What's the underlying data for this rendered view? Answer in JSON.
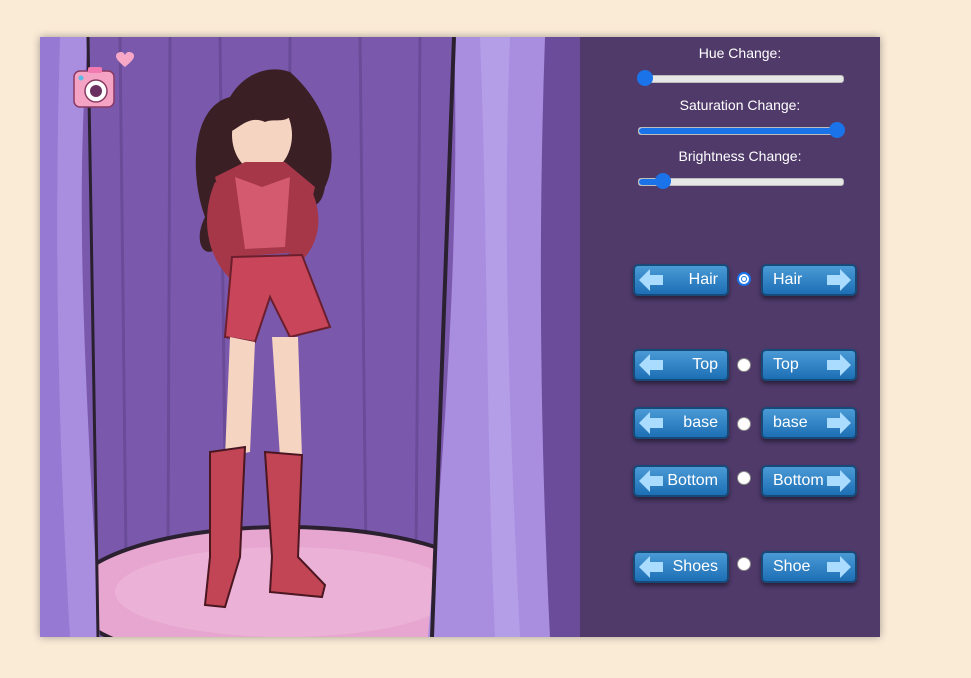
{
  "sliders": [
    {
      "label": "Hue Change:",
      "value": 0.03
    },
    {
      "label": "Saturation Change:",
      "value": 0.97
    },
    {
      "label": "Brightness Change:",
      "value": 0.12
    }
  ],
  "controls": [
    {
      "left_label": "Hair",
      "right_label": "Hair",
      "radio_checked": true
    },
    {
      "left_label": "Top",
      "right_label": "Top",
      "radio_checked": false
    },
    {
      "left_label": "base",
      "right_label": "base",
      "radio_checked": false
    },
    {
      "left_label": "Bottom",
      "right_label": "Bottom",
      "radio_checked": false
    },
    {
      "left_label": "Shoes",
      "right_label": "Shoe",
      "radio_checked": false
    }
  ],
  "colors": {
    "page_bg": "#faebd7",
    "panel_bg": "#4f3a6a",
    "accent": "#1a73e8",
    "button": "#2a7cc1"
  },
  "icons": [
    "camera-icon",
    "heart-icon",
    "arrow-left-icon",
    "arrow-right-icon"
  ]
}
